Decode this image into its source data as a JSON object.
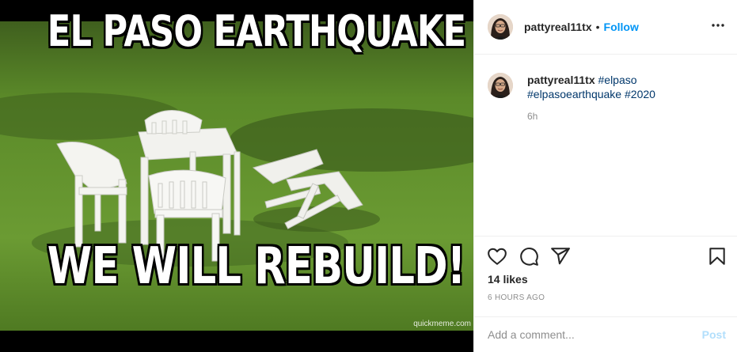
{
  "post": {
    "meme_top_text": "EL PASO EARTHQUAKE",
    "meme_bottom_text": "WE WILL REBUILD!",
    "watermark": "quickmeme.com"
  },
  "header": {
    "username": "pattyreal11tx",
    "separator": "•",
    "follow_label": "Follow",
    "more_icon": "more-horizontal-icon"
  },
  "caption": {
    "username": "pattyreal11tx",
    "hashtags": [
      "#elpaso",
      "#elpasoearthquake",
      "#2020"
    ],
    "time": "6h"
  },
  "actions": {
    "icons": [
      "heart-icon",
      "comment-icon",
      "share-icon",
      "bookmark-icon"
    ],
    "likes": "14 likes",
    "posted_ago": "6 HOURS AGO"
  },
  "comment_box": {
    "placeholder": "Add a comment...",
    "post_label": "Post"
  },
  "colors": {
    "accent": "#0095f6",
    "hashtag": "#00376b",
    "muted": "#8e8e8e",
    "post_disabled": "#b2dffc",
    "grass": "#5f8f2c"
  }
}
